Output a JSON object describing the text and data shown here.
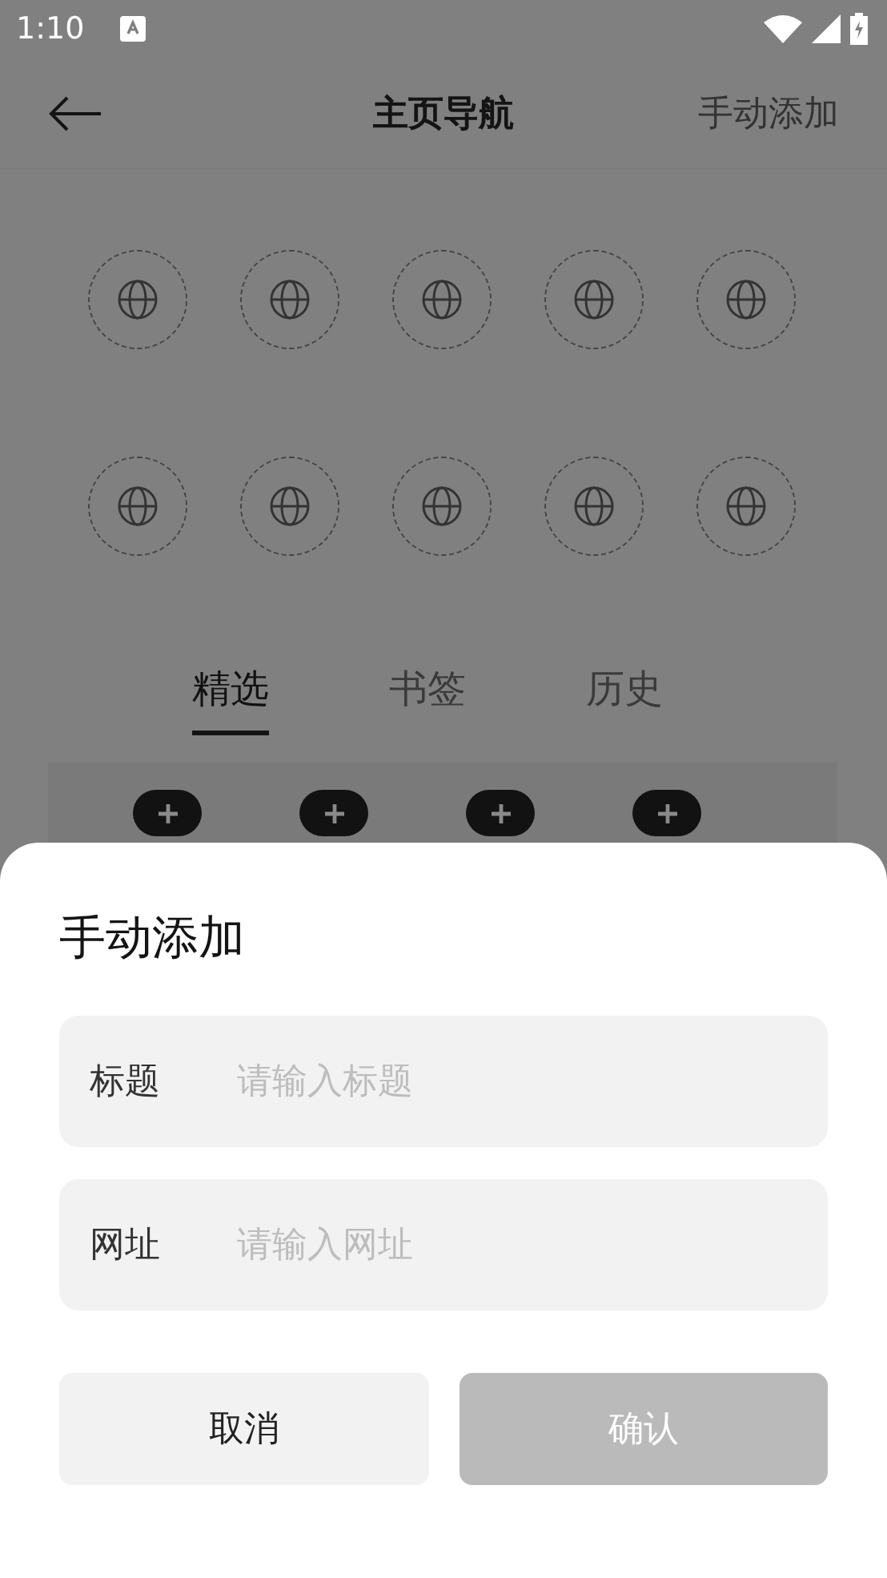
{
  "status_bar": {
    "time": "1:10"
  },
  "header": {
    "title": "主页导航",
    "action": "手动添加"
  },
  "shortcut_slots": [
    {
      "kind": "empty"
    },
    {
      "kind": "empty"
    },
    {
      "kind": "empty"
    },
    {
      "kind": "empty"
    },
    {
      "kind": "empty"
    },
    {
      "kind": "empty"
    },
    {
      "kind": "empty"
    },
    {
      "kind": "empty"
    },
    {
      "kind": "empty"
    },
    {
      "kind": "empty"
    }
  ],
  "tabs": [
    {
      "label": "精选",
      "selected": true
    },
    {
      "label": "书签",
      "selected": false
    },
    {
      "label": "历史",
      "selected": false
    }
  ],
  "dialog": {
    "title": "手动添加",
    "fields": [
      {
        "label": "标题",
        "placeholder": "请输入标题"
      },
      {
        "label": "网址",
        "placeholder": "请输入网址"
      }
    ],
    "buttons": [
      {
        "label": "取消",
        "kind": "secondary",
        "disabled": false
      },
      {
        "label": "确认",
        "kind": "primary",
        "disabled": true
      }
    ]
  }
}
